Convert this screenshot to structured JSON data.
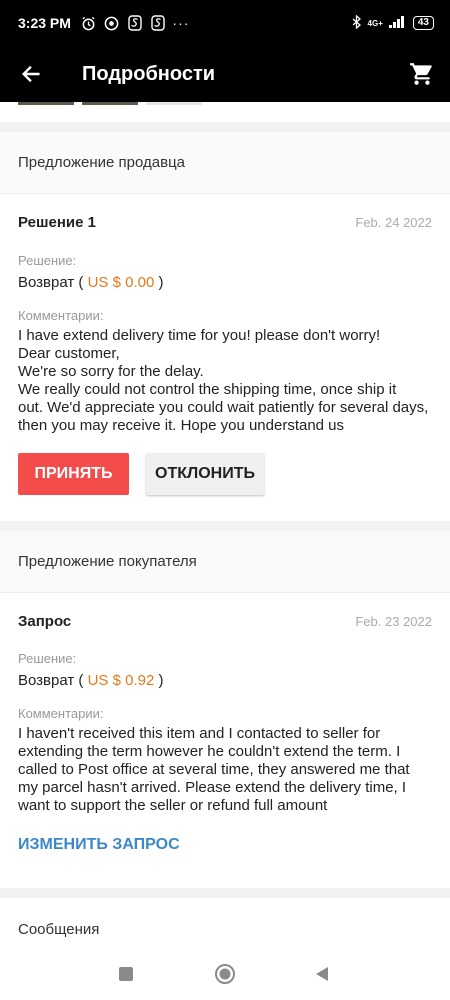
{
  "status_bar": {
    "time": "3:23 PM",
    "network": "4G+",
    "battery": "43"
  },
  "app_bar": {
    "title": "Подробности"
  },
  "seller_offer": {
    "section_title": "Предложение продавца",
    "title": "Решение 1",
    "date": "Feb. 24 2022",
    "solution_label": "Решение:",
    "solution_value": "Возврат",
    "amount": "US $ 0.00",
    "comments_label": "Комментарии:",
    "comment_lines": [
      "I have extend delivery time for you! please don't worry!",
      "Dear customer,",
      "We're so sorry for the delay.",
      "We really could not control the shipping time, once ship it",
      "out. We'd appreciate you could wait patiently for several days,",
      "then you may receive it. Hope you understand us"
    ],
    "accept_label": "ПРИНЯТЬ",
    "decline_label": "ОТКЛОНИТЬ"
  },
  "buyer_offer": {
    "section_title": "Предложение покупателя",
    "title": "Запрос",
    "date": "Feb. 23 2022",
    "solution_label": "Решение:",
    "solution_value": "Возврат",
    "amount": "US $ 0.92",
    "comments_label": "Комментарии:",
    "comment_lines": [
      "I haven't received this item and I contacted to seller for",
      "extending the term however he couldn't extend the term. I",
      "called to Post office at several time, they answered me that",
      "my parcel hasn't arrived. Please extend the delivery time, I",
      "want to support the seller or refund full amount"
    ],
    "edit_label": "ИЗМЕНИТЬ ЗАПРОС"
  },
  "messages": {
    "section_title": "Сообщения"
  },
  "colors": {
    "accent_red": "#f44b4b",
    "money_orange": "#e07b1a",
    "link_blue": "#3d88c9"
  }
}
